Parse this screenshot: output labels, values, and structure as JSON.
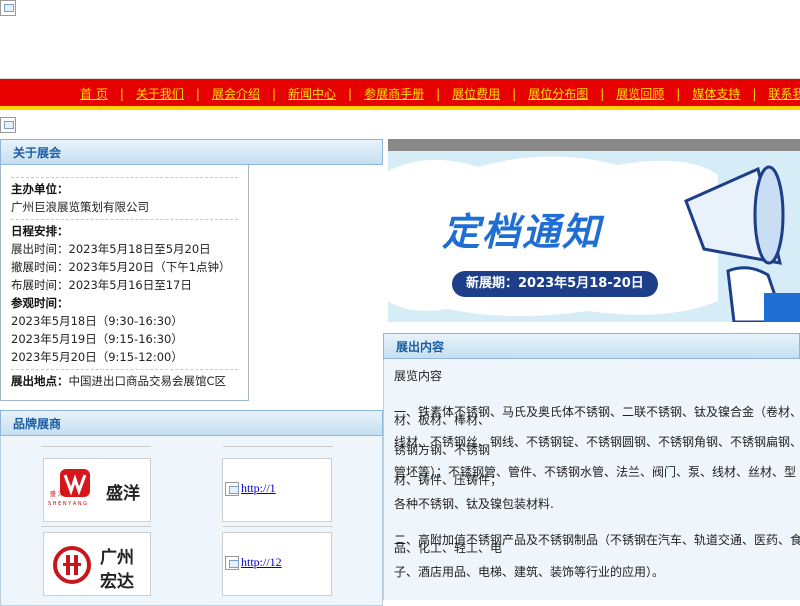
{
  "nav": {
    "items": [
      "首 页",
      "关于我们",
      "展会介绍",
      "新闻中心",
      "参展商手册",
      "展位费用",
      "展位分布图",
      "展览回顾",
      "媒体支持",
      "联系我们"
    ]
  },
  "about": {
    "heading": "关于展会",
    "organizer_label": "主办单位：",
    "organizer": "广州巨浪展览策划有限公司",
    "schedule_label": "日程安排：",
    "exhibit_time": "展出时间：2023年5月18日至5月20日",
    "close_time": "撤展时间：2023年5月20日（下午1点钟）",
    "setup_time": "布展时间：2023年5月16日至17日",
    "visit_label": "参观时间：",
    "visit_1": "2023年5月18日（9:30-16:30）",
    "visit_2": "2023年5月19日（9:15-16:30）",
    "visit_3": "2023年5月20日（9:15-12:00）",
    "venue_label": "展出地点：",
    "venue": "中国进出口商品交易会展馆C区"
  },
  "brands": {
    "heading": "品牌展商",
    "logo1_text": "盛洋",
    "logo1_small": "盛  洋",
    "logo1_latin": "S H E N Y A N G",
    "logo2_line1": "广州",
    "logo2_line2": "宏达",
    "link1": "http://1",
    "link2": "http://12"
  },
  "banner": {
    "title": "定档通知",
    "date": "新展期：2023年5月18-20日"
  },
  "exhibits": {
    "heading": "展出内容",
    "intro": "展览内容",
    "p1a": "一、铁素体不锈钢、马氏及奥氏体不锈钢、二联不锈钢、钛及镍合金（卷材、",
    "p1b": "材、板材、棒材、",
    "p2a": "线材、不锈钢丝、钢线、不锈钢锭、不锈钢圆钢、不锈钢角钢、不锈钢扁钢、",
    "p2b": "锈钢方钢、不锈钢",
    "p3a": "管坯等）；不锈钢管、管件、不锈钢水管、法兰、阀门、泵、线材、丝材、型",
    "p3b": "材、铸件、压铸件；",
    "p4": "各种不锈钢、钛及镍包装材料.",
    "p5a": "二、高附加值不锈钢产品及不锈钢制品（不锈钢在汽车、轨道交通、医药、食",
    "p5b": "品、化工、轻工、电",
    "p6": "子、酒店用品、电梯、建筑、装饰等行业的应用）。"
  },
  "colors": {
    "nav_bg": "#e60000",
    "nav_text": "#ffe000",
    "nav_border": "#ffd400",
    "panel_title": "#1b5ea0",
    "banner_title": "#1f6ed4"
  }
}
